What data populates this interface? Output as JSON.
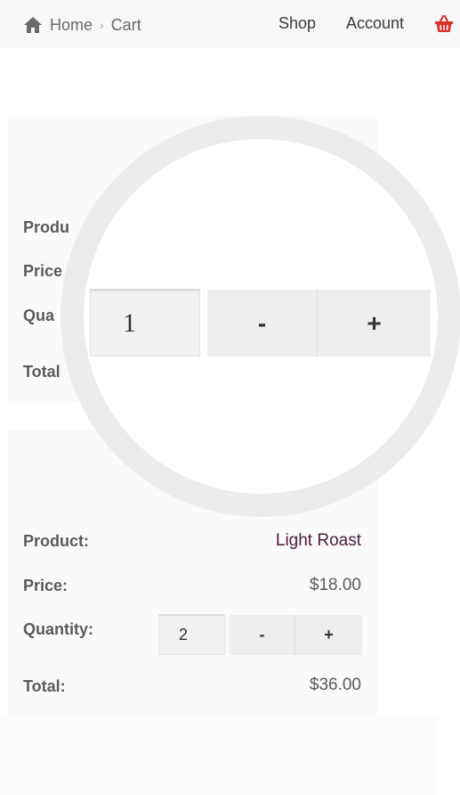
{
  "header": {
    "breadcrumb": {
      "home_icon": "home-icon",
      "home_label": "Home",
      "separator": "›",
      "current": "Cart"
    },
    "nav": {
      "shop_label": "Shop",
      "account_label": "Account",
      "cart_icon": "basket-icon",
      "cart_icon_color": "#d9302c"
    }
  },
  "cart_items": [
    {
      "product_label": "Produ",
      "price_label": "Price",
      "quantity_label": "Qua",
      "total_label": "Total",
      "quantity": "1",
      "decrement_label": "-",
      "increment_label": "+"
    },
    {
      "product_label": "Product:",
      "product_name": "Light Roast",
      "price_label": "Price:",
      "price": "$18.00",
      "quantity_label": "Quantity:",
      "quantity": "2",
      "decrement_label": "-",
      "increment_label": "+",
      "total_label": "Total:",
      "total": "$36.00"
    }
  ],
  "colors": {
    "product_name": "#4a1d3c",
    "card_background": "#fafafa",
    "magnifier_ring": "#ececec"
  }
}
